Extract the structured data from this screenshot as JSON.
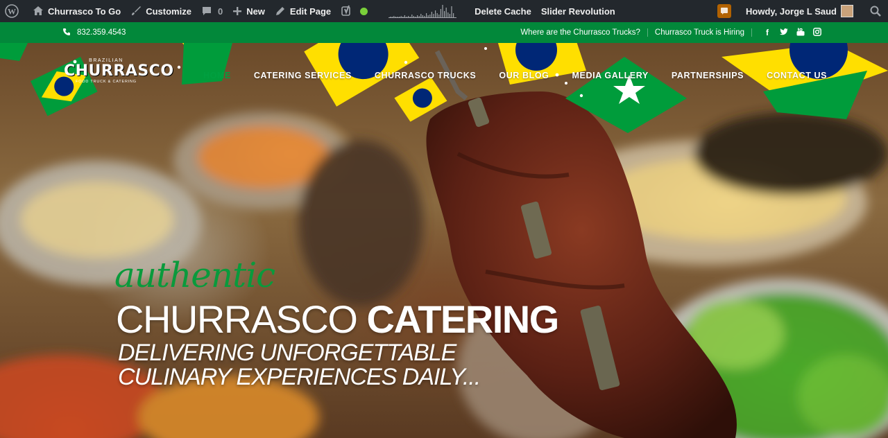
{
  "admin_bar": {
    "site_name": "Churrasco To Go",
    "customize": "Customize",
    "comments_count": "0",
    "new": "New",
    "edit_page": "Edit Page",
    "delete_cache": "Delete Cache",
    "slider_revolution": "Slider Revolution",
    "howdy": "Howdy, Jorge L Saud",
    "seo_status_color": "#7ad03a"
  },
  "top_bar": {
    "phone": "832.359.4543",
    "links": [
      "Where are the Churrasco Trucks?",
      "Churrasco Truck is Hiring"
    ],
    "social": [
      "facebook-icon",
      "twitter-icon",
      "youtube-icon",
      "instagram-icon"
    ]
  },
  "logo": {
    "top": "BRAZILIAN",
    "main": "CHURRASCO",
    "sub": "FOOD TRUCK & CATERING"
  },
  "nav": {
    "items": [
      "HOME",
      "CATERING SERVICES",
      "CHURRASCO TRUCKS",
      "OUR BLOG",
      "MEDIA GALLERY",
      "PARTNERSHIPS",
      "CONTACT US"
    ],
    "active_color": "#00a040"
  },
  "hero": {
    "script": "authentic",
    "title_light": "CHURRASCO ",
    "title_bold": "CATERING",
    "subtitle_line1": "DELIVERING UNFORGETTABLE",
    "subtitle_line2": "CULINARY EXPERIENCES DAILY..."
  },
  "colors": {
    "brazil_green": "#009c3b",
    "brazil_yellow": "#ffdf00",
    "brazil_blue": "#002776"
  }
}
